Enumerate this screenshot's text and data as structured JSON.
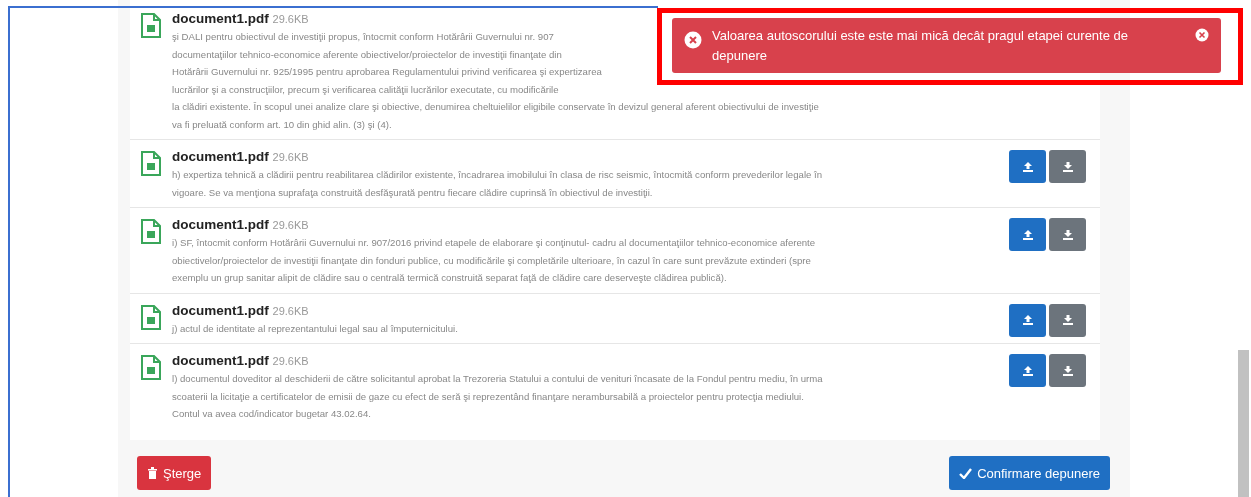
{
  "documents": [
    {
      "name": "document1.pdf",
      "size": "29.6KB",
      "lines": [
        "şi DALI pentru obiectivul de investiţii propus, întocmit conform Hotărârii Guvernului nr. 907",
        "documentaţiilor tehnico-economice aferente obiectivelor/proiectelor de investiţii finanţate din",
        "Hotărârii Guvernului nr. 925/1995 pentru aprobarea Regulamentului privind verificarea şi expertizarea",
        "lucrărilor şi a construcţiilor, precum şi verificarea calităţii lucrărilor executate, cu modificările",
        "la clădiri existente. În scopul unei analize clare şi obiective, denumirea cheltuielilor eligibile conservate în devizul general aferent obiectivului de investiţie",
        "va fi preluată conform art. 10 din ghid alin. (3) şi (4)."
      ]
    },
    {
      "name": "document1.pdf",
      "size": "29.6KB",
      "lines": [
        "h) expertiza tehnică a clădirii pentru reabilitarea clădirilor existente, încadrarea imobilului în clasa de risc seismic, întocmită conform prevederilor legale în",
        "vigoare. Se va menţiona suprafaţa construită desfăşurată pentru fiecare clădire cuprinsă în obiectivul de investiţii."
      ]
    },
    {
      "name": "document1.pdf",
      "size": "29.6KB",
      "lines": [
        "i) SF, întocmit conform Hotărârii Guvernului nr. 907/2016 privind etapele de elaborare şi conţinutul- cadru al documentaţiilor tehnico-economice aferente",
        "obiectivelor/proiectelor de investiţii finanţate din fonduri publice, cu modificările şi completările ulterioare, în cazul în care sunt prevăzute extinderi (spre",
        "exemplu un grup sanitar alipit de clădire sau o centrală termică construită separat faţă de clădire care deserveşte clădirea publică)."
      ]
    },
    {
      "name": "document1.pdf",
      "size": "29.6KB",
      "lines": [
        "j) actul de identitate al reprezentantului legal sau al împuternicitului."
      ]
    },
    {
      "name": "document1.pdf",
      "size": "29.6KB",
      "lines": [
        "l) documentul doveditor al deschiderii de către solicitantul aprobat la Trezoreria Statului a contului de venituri încasate de la Fondul pentru mediu, în urma",
        "scoaterii la licitaţie a certificatelor de emisii de gaze cu efect de seră şi reprezentând finanţare nerambursabilă a proiectelor pentru protecţia mediului.",
        "Contul va avea cod/indicator bugetar 43.02.64."
      ]
    }
  ],
  "actions": {
    "delete": "Şterge",
    "confirm": "Confirmare depunere"
  },
  "toast": {
    "message": "Valoarea autoscorului este este mai mică decât pragul etapei curente de depunere"
  }
}
